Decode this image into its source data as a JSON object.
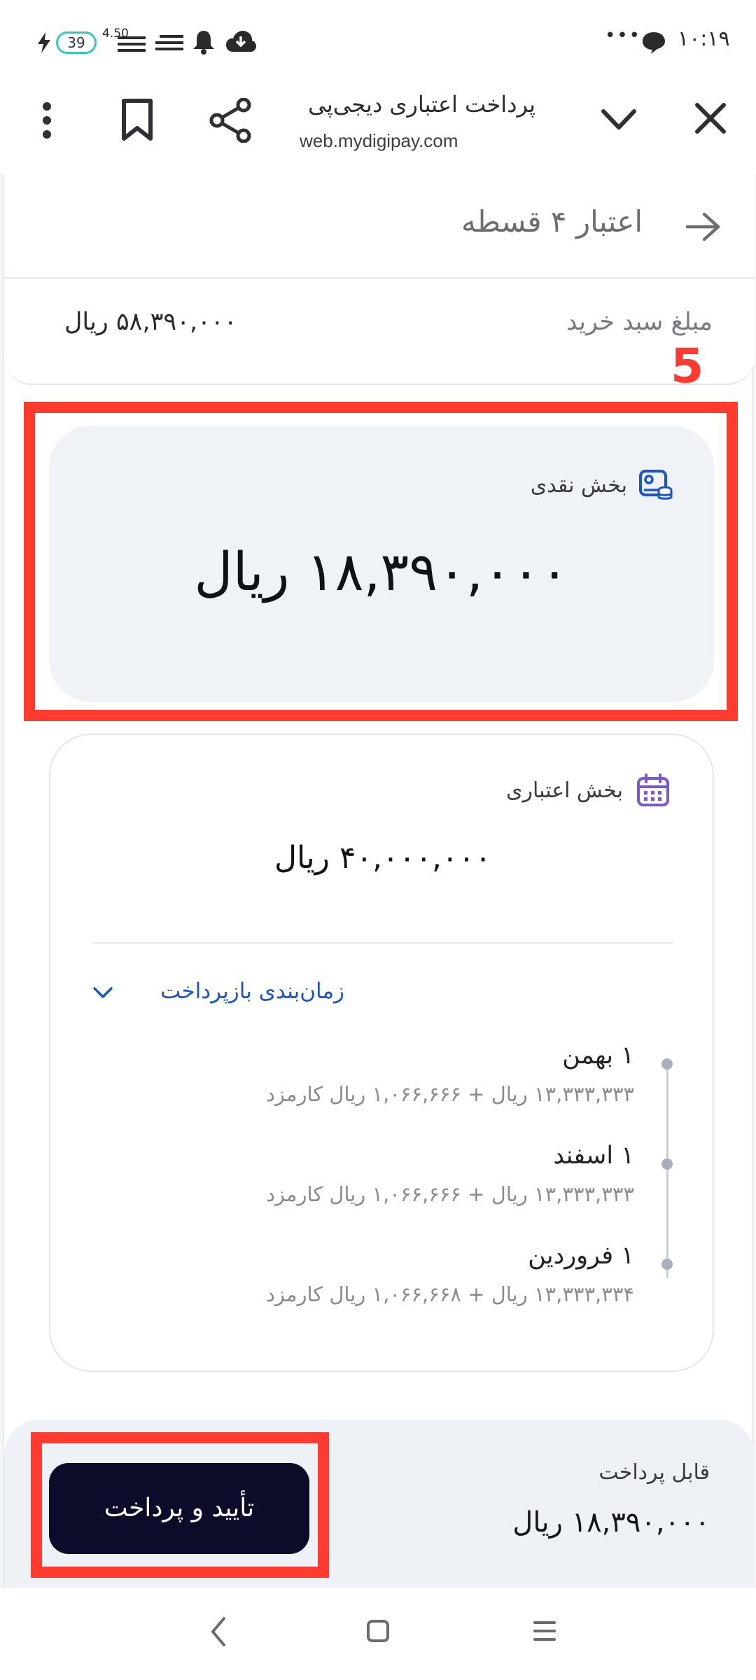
{
  "status_bar": {
    "time": "۱۰:۱۹",
    "battery": "39",
    "net_speed": "4.50",
    "more_dots": "•••"
  },
  "browser": {
    "title": "پرداخت اعتباری دیجی‌پی",
    "url": "web.mydigipay.com"
  },
  "header": {
    "title": "اعتبار ۴ قسطه"
  },
  "basket": {
    "label": "مبلغ سبد خرید",
    "amount": "۵۸,۳۹۰,۰۰۰ ریال"
  },
  "cash_part": {
    "label": "بخش نقدی",
    "amount": "۱۸,۳۹۰,۰۰۰ ریال"
  },
  "credit_part": {
    "label": "بخش اعتباری",
    "amount": "۴۰,۰۰۰,۰۰۰ ریال",
    "schedule_toggle": "زمان‌بندی بازپرداخت",
    "installments": [
      {
        "title": "۱ بهمن",
        "detail": "۱۳,۳۳۳,۳۳۳ ریال + ۱,۰۶۶,۶۶۶ ریال کارمزد"
      },
      {
        "title": "۱ اسفند",
        "detail": "۱۳,۳۳۳,۳۳۳ ریال + ۱,۰۶۶,۶۶۶ ریال کارمزد"
      },
      {
        "title": "۱ فروردین",
        "detail": "۱۳,۳۳۳,۳۳۴ ریال + ۱,۰۶۶,۶۶۸ ریال کارمزد"
      }
    ]
  },
  "payment": {
    "payable_label": "قابل پرداخت",
    "payable_amount": "۱۸,۳۹۰,۰۰۰ ریال",
    "confirm_button": "تأیید و پرداخت"
  },
  "annotation": {
    "step_number": "5"
  },
  "colors": {
    "accent_blue": "#1b54c9",
    "button_dark": "#0b0c2a",
    "annotation_red": "#ff3b30"
  }
}
